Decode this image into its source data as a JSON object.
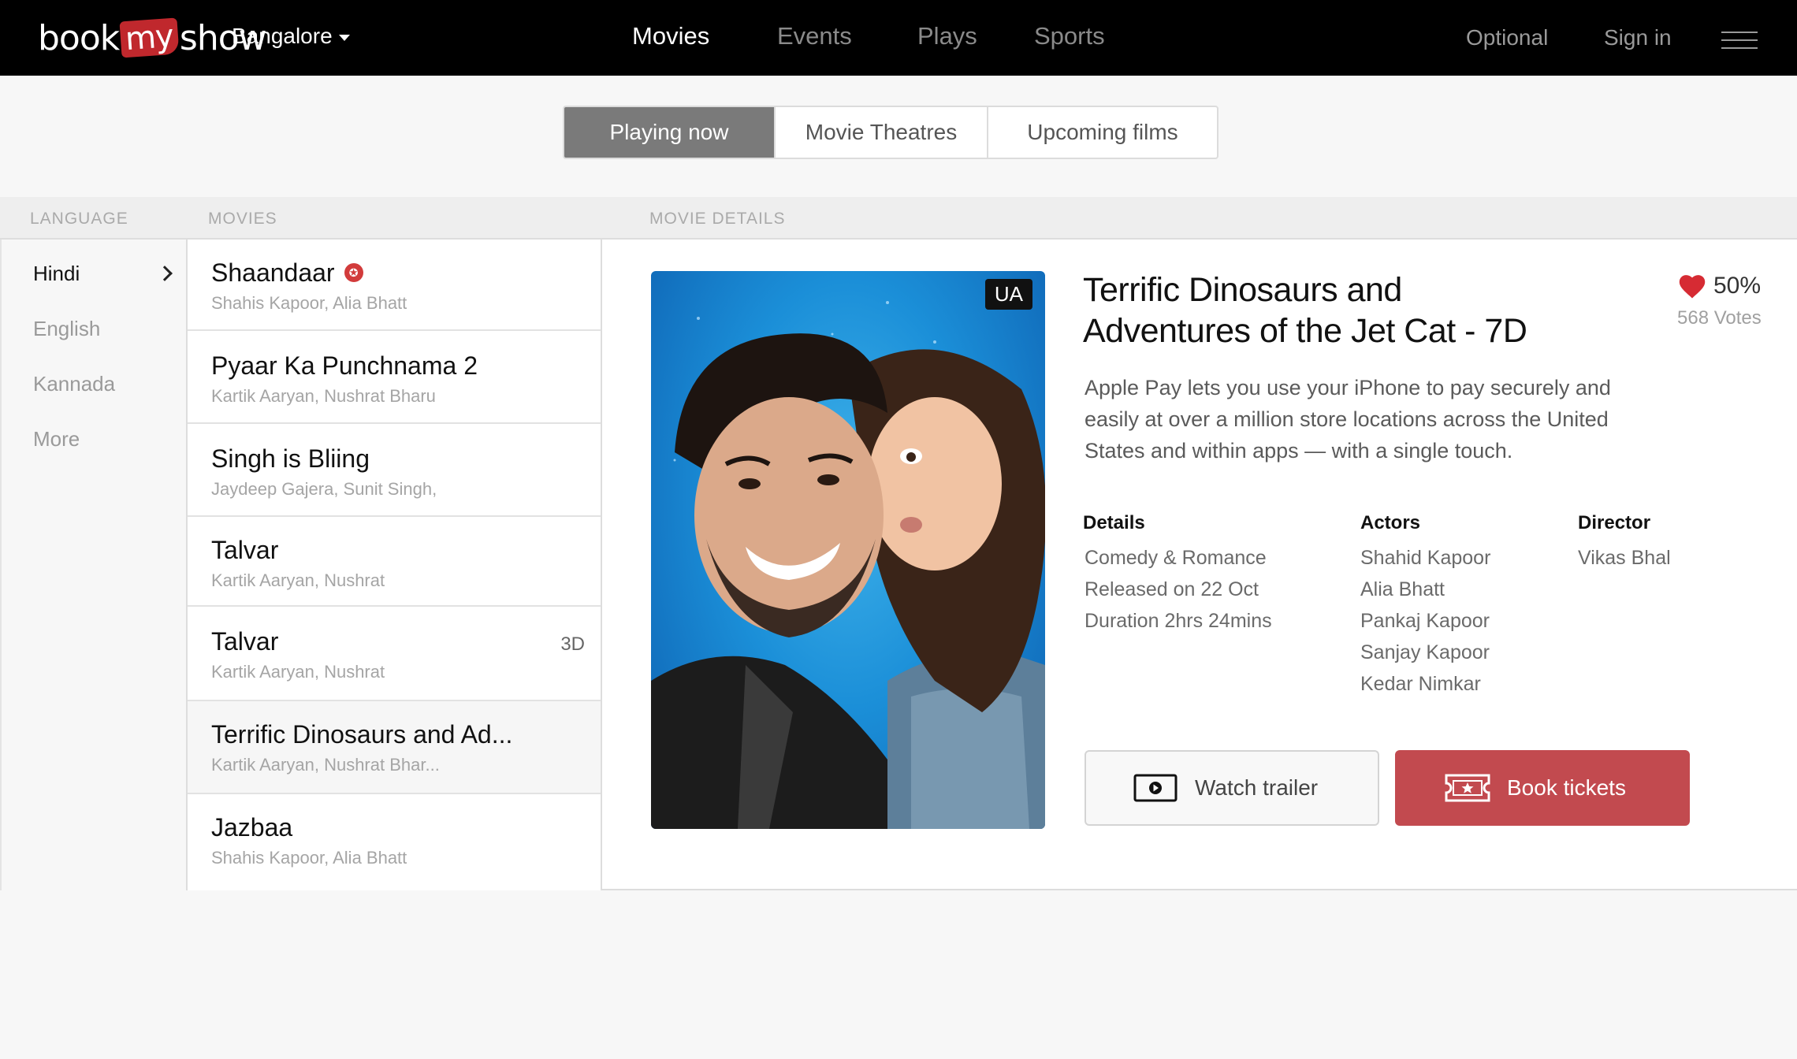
{
  "header": {
    "logo": {
      "pre": "book",
      "my": "my",
      "post": "show"
    },
    "city": "Bangalore",
    "nav": [
      {
        "label": "Movies",
        "active": true
      },
      {
        "label": "Events",
        "active": false
      },
      {
        "label": "Plays",
        "active": false
      },
      {
        "label": "Sports",
        "active": false
      }
    ],
    "optional": "Optional",
    "signin": "Sign in"
  },
  "tabs": [
    {
      "label": "Playing now",
      "active": true
    },
    {
      "label": "Movie Theatres",
      "active": false
    },
    {
      "label": "Upcoming films",
      "active": false
    }
  ],
  "columns": {
    "language": "LANGUAGE",
    "movies": "MOVIES",
    "details": "MOVIE DETAILS"
  },
  "languages": [
    {
      "label": "Hindi",
      "active": true
    },
    {
      "label": "English",
      "active": false
    },
    {
      "label": "Kannada",
      "active": false
    },
    {
      "label": "More",
      "active": false
    }
  ],
  "movies": [
    {
      "title": "Shaandaar",
      "cast": "Shahis Kapoor, Alia Bhatt",
      "badge": "✪",
      "tag": ""
    },
    {
      "title": "Pyaar Ka Punchnama 2",
      "cast": "Kartik Aaryan, Nushrat Bharu",
      "tag": ""
    },
    {
      "title": "Singh is Bliing",
      "cast": "Jaydeep Gajera, Sunit Singh,",
      "tag": ""
    },
    {
      "title": "Talvar",
      "cast": "Kartik Aaryan, Nushrat",
      "tag": ""
    },
    {
      "title": "Talvar",
      "cast": "Kartik Aaryan, Nushrat",
      "tag": "3D"
    },
    {
      "title": "Terrific Dinosaurs and Ad...",
      "cast": "Kartik Aaryan, Nushrat Bhar...",
      "tag": "",
      "selected": true
    },
    {
      "title": "Jazbaa",
      "cast": "Shahis Kapoor, Alia Bhatt",
      "tag": ""
    }
  ],
  "detail": {
    "certificate": "UA",
    "title": "Terrific Dinosaurs and Adventures of the Jet Cat - 7D",
    "rating": "50%",
    "votes": "568 Votes",
    "description": "Apple Pay lets you use your iPhone to pay securely and easily at over a million store locations across the United States and within apps — with a single touch.",
    "details_heading": "Details",
    "details": [
      "Comedy & Romance",
      "Released on 22 Oct",
      "Duration 2hrs 24mins"
    ],
    "actors_heading": "Actors",
    "actors": [
      "Shahid Kapoor",
      "Alia Bhatt",
      "Pankaj Kapoor",
      "Sanjay Kapoor",
      "Kedar Nimkar"
    ],
    "director_heading": "Director",
    "director": [
      "Vikas Bhal"
    ],
    "watch_trailer": "Watch trailer",
    "book_tickets": "Book tickets"
  },
  "colors": {
    "brand_red": "#c24a4f",
    "heart": "#d62b33",
    "nav_bg": "#000000"
  }
}
